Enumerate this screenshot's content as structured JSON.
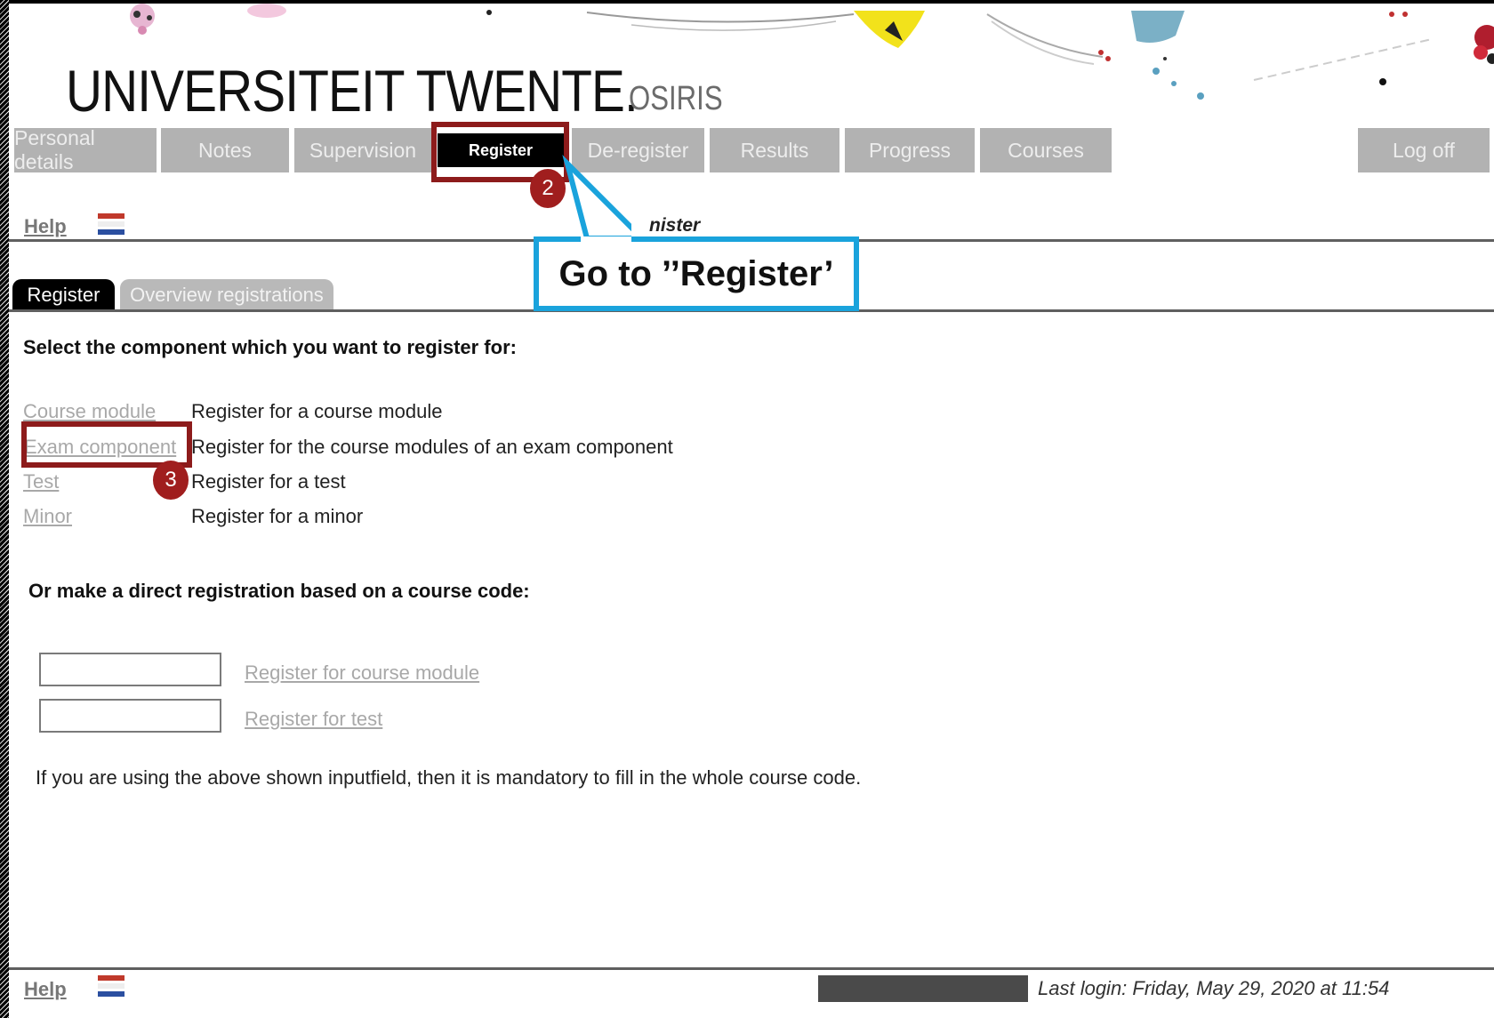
{
  "header": {
    "logo": "UNIVERSITEIT TWENTE.",
    "app_name": "OSIRIS"
  },
  "nav": {
    "items": [
      {
        "label": "Personal details"
      },
      {
        "label": "Notes"
      },
      {
        "label": "Supervision"
      },
      {
        "label": "Register"
      },
      {
        "label": "De-register"
      },
      {
        "label": "Results"
      },
      {
        "label": "Progress"
      },
      {
        "label": "Courses"
      }
    ],
    "logoff": "Log off"
  },
  "toolbar": {
    "help": "Help",
    "page_title_fragment": "nister"
  },
  "tabs": [
    {
      "label": "Register"
    },
    {
      "label": "Overview registrations"
    }
  ],
  "annotations": {
    "step2": "2",
    "step3": "3",
    "callout": "Go to ’’Register’"
  },
  "content": {
    "select_heading": "Select the component which you want to register for:",
    "options": [
      {
        "link": "Course module",
        "description": "Register for a course module"
      },
      {
        "link": "Exam component",
        "description": "Register for the course modules of an exam component"
      },
      {
        "link": "Test",
        "description": "Register for a test"
      },
      {
        "link": "Minor",
        "description": "Register for a minor"
      }
    ],
    "direct_heading": "Or make a direct registration based on a course code:",
    "direct": [
      {
        "input_value": "",
        "link": "Register for course module"
      },
      {
        "input_value": "",
        "link": "Register for test"
      }
    ],
    "note": "If you are using the above shown inputfield, then it is mandatory to fill in the whole course code."
  },
  "footer": {
    "help": "Help",
    "last_login": "Last login: Friday, May 29, 2020 at 11:54"
  },
  "colors": {
    "nav_bg": "#b2b2b2",
    "nav_active": "#000000",
    "annotation_red": "#8d1b1b",
    "callout_blue": "#1aa3dc"
  }
}
